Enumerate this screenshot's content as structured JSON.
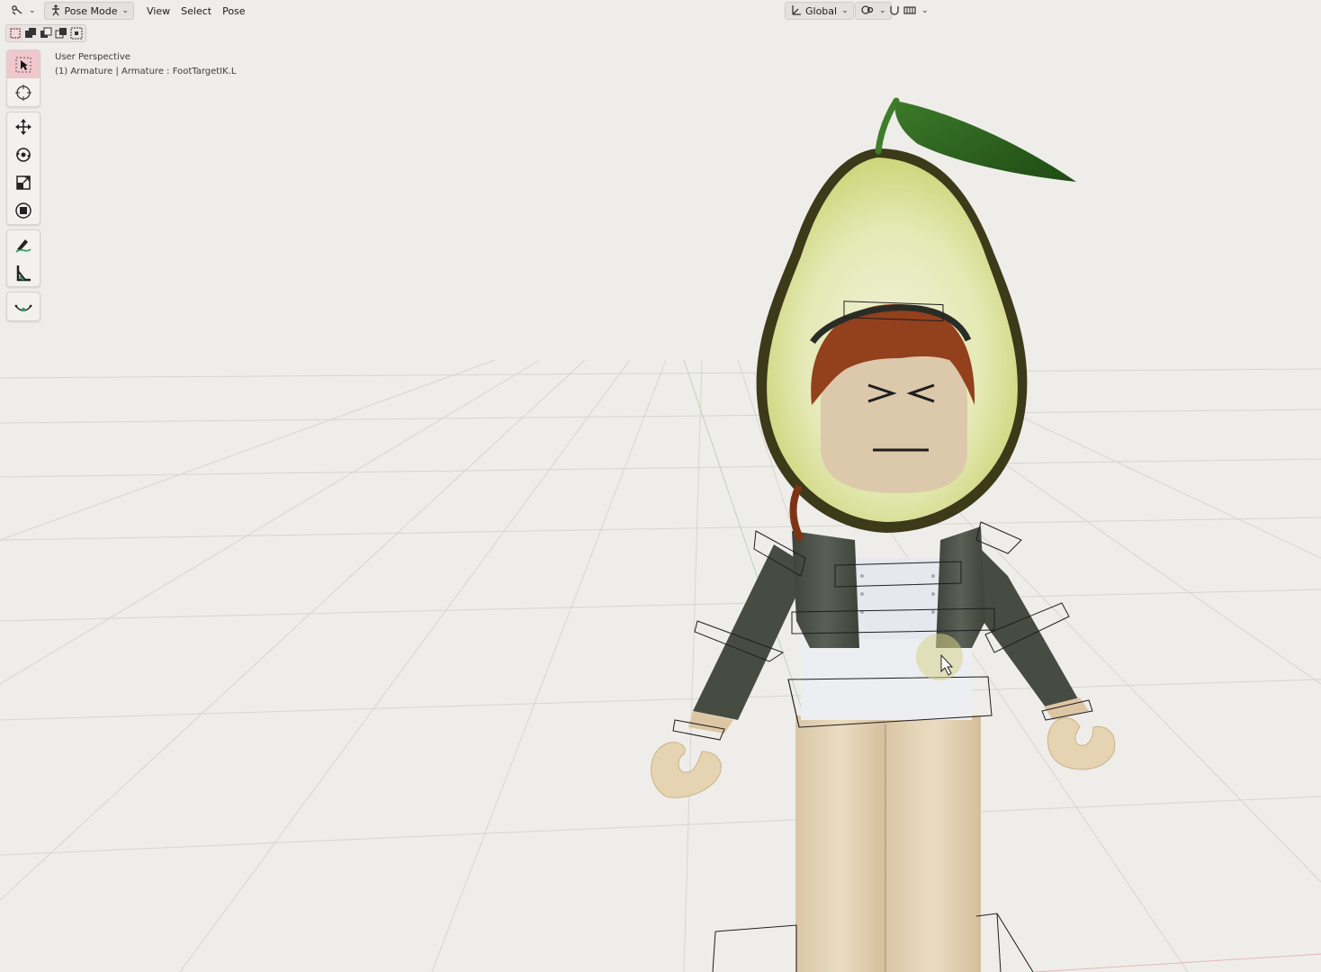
{
  "header": {
    "mode_label": "Pose Mode",
    "menus": [
      "View",
      "Select",
      "Pose"
    ],
    "orientation_label": "Global",
    "icons": {
      "editor_type": "armature-pose-icon",
      "mode": "pose-figure-icon",
      "orientation": "transform-axes-icon",
      "pivot": "pivot-icon",
      "snap": "snap-magnet-icon",
      "proportional": "proportional-editing-icon"
    }
  },
  "select_modes": [
    "select-new-icon",
    "select-extend-icon",
    "select-subtract-icon",
    "select-invert-icon",
    "select-intersect-icon"
  ],
  "viewport": {
    "view_name": "User Perspective",
    "object_info": "(1) Armature | Armature : FootTargetIK.L"
  },
  "toolbar": {
    "groups": [
      [
        "select-box-icon",
        "cursor-icon"
      ],
      [
        "move-icon",
        "rotate-icon",
        "scale-icon",
        "transform-icon"
      ],
      [
        "annotate-icon",
        "measure-icon"
      ],
      [
        "pose-relax-icon"
      ]
    ],
    "active_tool": "select-box-icon"
  },
  "colors": {
    "viewport_bg": "#efede9",
    "grid": "#d9d6d1",
    "active_tool_bg": "#f0c7cb",
    "avocado_skin": "#3b3a1d",
    "avocado_flesh": "#e9eec4",
    "hair": "#8e3a1b",
    "skin": "#ddc6a4",
    "jacket": "#4c5147",
    "shirt": "#e9ebf0",
    "pants": "#e4d2b4"
  }
}
